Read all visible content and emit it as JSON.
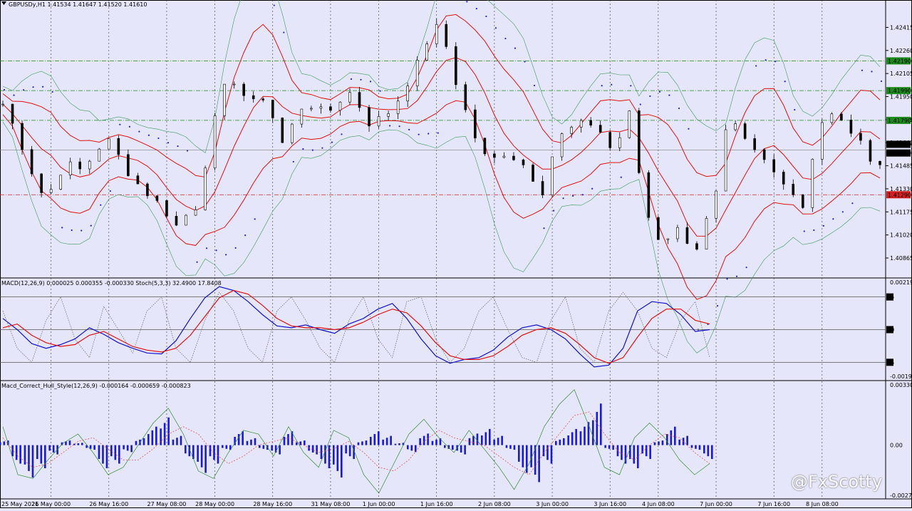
{
  "chart_data": [
    {
      "type": "candlestick",
      "title": "GBPUSDy,H1  1.41534 1.41647 1.41520 1.41610",
      "ylim": [
        1.4075,
        1.4258
      ],
      "price_ticks": [
        "1.42415",
        "1.42260",
        "1.42105",
        "1.41950",
        "1.41795",
        "1.41640",
        "1.41485",
        "1.41330",
        "1.41175",
        "1.41020",
        "1.40865"
      ],
      "price_tick_values": [
        1.42415,
        1.4226,
        1.42105,
        1.4195,
        1.41795,
        1.4164,
        1.41485,
        1.4133,
        1.41175,
        1.4102,
        1.40865
      ],
      "levels": [
        {
          "label": "1.42190",
          "value": 1.4219,
          "color": "#1a8a1a"
        },
        {
          "label": "1.41990",
          "value": 1.4199,
          "color": "#1a8a1a"
        },
        {
          "label": "1.41790",
          "value": 1.4179,
          "color": "#1a8a1a"
        },
        {
          "label": "1.41290",
          "value": 1.4129,
          "color": "#d62020"
        }
      ],
      "price_boxes": [
        {
          "label": "1.41610",
          "value": 1.4161
        },
        {
          "label": "1.41590",
          "value": 1.4159
        }
      ],
      "close_path": [
        [
          0,
          1.419
        ],
        [
          1,
          1.4175
        ],
        [
          2,
          1.4158
        ],
        [
          3,
          1.4138
        ],
        [
          4,
          1.4125
        ],
        [
          5,
          1.4142
        ],
        [
          6,
          1.415
        ],
        [
          7,
          1.4145
        ],
        [
          8,
          1.4152
        ],
        [
          9,
          1.4162
        ],
        [
          10,
          1.4166
        ],
        [
          11,
          1.415
        ],
        [
          12,
          1.414
        ],
        [
          13,
          1.4132
        ],
        [
          14,
          1.4126
        ],
        [
          15,
          1.4118
        ],
        [
          16,
          1.4108
        ],
        [
          17,
          1.4116
        ],
        [
          18,
          1.4122
        ],
        [
          19,
          1.4162
        ],
        [
          20,
          1.4192
        ],
        [
          21,
          1.421
        ],
        [
          22,
          1.4198
        ],
        [
          23,
          1.419
        ],
        [
          24,
          1.4195
        ],
        [
          25,
          1.418
        ],
        [
          26,
          1.416
        ],
        [
          27,
          1.4182
        ],
        [
          28,
          1.4192
        ],
        [
          29,
          1.4186
        ],
        [
          30,
          1.4184
        ],
        [
          31,
          1.4192
        ],
        [
          32,
          1.4198
        ],
        [
          33,
          1.4188
        ],
        [
          34,
          1.4175
        ],
        [
          35,
          1.4182
        ],
        [
          36,
          1.4186
        ],
        [
          37,
          1.42
        ],
        [
          38,
          1.4212
        ],
        [
          39,
          1.423
        ],
        [
          40,
          1.4242
        ],
        [
          41,
          1.4228
        ],
        [
          42,
          1.42
        ],
        [
          43,
          1.418
        ],
        [
          44,
          1.416
        ],
        [
          45,
          1.415
        ],
        [
          46,
          1.4158
        ],
        [
          47,
          1.4155
        ],
        [
          48,
          1.415
        ],
        [
          49,
          1.414
        ],
        [
          50,
          1.413
        ],
        [
          51,
          1.4164
        ],
        [
          52,
          1.4172
        ],
        [
          53,
          1.4175
        ],
        [
          54,
          1.4178
        ],
        [
          55,
          1.4174
        ],
        [
          56,
          1.416
        ],
        [
          57,
          1.4168
        ],
        [
          58,
          1.4186
        ],
        [
          59,
          1.413
        ],
        [
          60,
          1.4105
        ],
        [
          61,
          1.4096
        ],
        [
          62,
          1.4108
        ],
        [
          63,
          1.41
        ],
        [
          64,
          1.4092
        ],
        [
          65,
          1.4112
        ],
        [
          66,
          1.4132
        ],
        [
          67,
          1.4182
        ],
        [
          68,
          1.417
        ],
        [
          69,
          1.416
        ],
        [
          70,
          1.4155
        ],
        [
          71,
          1.4145
        ],
        [
          72,
          1.414
        ],
        [
          73,
          1.413
        ],
        [
          74,
          1.412
        ],
        [
          75,
          1.4165
        ],
        [
          76,
          1.4185
        ],
        [
          77,
          1.418
        ],
        [
          78,
          1.4175
        ],
        [
          79,
          1.4165
        ],
        [
          80,
          1.4155
        ],
        [
          81,
          1.415
        ]
      ],
      "x_ticks": [
        "25 May 2021",
        "26 May 00:00",
        "26 May 16:00",
        "27 May 08:00",
        "28 May 00:00",
        "28 May 16:00",
        "31 May 08:00",
        "1 Jun 00:00",
        "1 Jun 16:00",
        "2 Jun 08:00",
        "3 Jun 00:00",
        "3 Jun 16:00",
        "4 Jun 08:00",
        "7 Jun 00:00",
        "7 Jun 16:00",
        "8 Jun 08:00"
      ],
      "x_tick_index": [
        0,
        5,
        11,
        17,
        22,
        28,
        34,
        39,
        45,
        51,
        57,
        63,
        68,
        74,
        80,
        85
      ]
    },
    {
      "type": "line",
      "title": "MACD(12,26,9) 0.000025 0.000355 -0.000330  Stoch(5,3,3) 32.4900 17.8408",
      "right_ticks": [
        "0.002199",
        "-0.00198"
      ],
      "stoch_levels": [
        {
          "label": "85",
          "value": 85
        },
        {
          "label": "50",
          "value": 50
        },
        {
          "label": "15",
          "value": 15
        }
      ],
      "series": [
        {
          "name": "",
          "color": "#1010d0",
          "values": [
            62,
            50,
            35,
            30,
            34,
            40,
            52,
            45,
            36,
            30,
            25,
            24,
            38,
            62,
            84,
            96,
            92,
            80,
            66,
            54,
            52,
            55,
            50,
            46,
            56,
            62,
            72,
            78,
            62,
            40,
            22,
            14,
            18,
            20,
            28,
            42,
            52,
            55,
            50,
            40,
            24,
            10,
            12,
            30,
            70,
            80,
            78,
            66,
            48,
            50
          ]
        },
        {
          "name": "",
          "color": "#e01010",
          "values": [
            52,
            56,
            44,
            36,
            32,
            34,
            44,
            48,
            40,
            32,
            28,
            26,
            30,
            44,
            64,
            84,
            92,
            88,
            76,
            62,
            54,
            52,
            52,
            50,
            52,
            58,
            66,
            72,
            68,
            54,
            36,
            22,
            18,
            18,
            22,
            32,
            44,
            50,
            52,
            46,
            34,
            20,
            14,
            20,
            42,
            62,
            72,
            72,
            60,
            56
          ]
        },
        {
          "name": "",
          "color": "#606060",
          "dashed": true,
          "values": [
            70,
            30,
            15,
            60,
            85,
            40,
            20,
            75,
            50,
            25,
            70,
            85,
            30,
            15,
            60,
            90,
            70,
            30,
            15,
            70,
            85,
            60,
            30,
            15,
            60,
            85,
            40,
            20,
            80,
            85,
            40,
            15,
            30,
            70,
            85,
            50,
            20,
            15,
            60,
            85,
            30,
            15,
            70,
            90,
            70,
            30,
            20,
            60,
            80,
            20
          ]
        }
      ]
    },
    {
      "type": "bar",
      "title": "Macd_Correct_Hull_Style(12,26,9) -0.000164 -0.000659 -0.000823",
      "right_ticks": [
        "0.003301",
        "0.00",
        "-0.002754"
      ],
      "ylim": [
        -0.002754,
        0.003301
      ],
      "values": [
        0.0002,
        -0.0008,
        -0.0014,
        -0.001,
        -0.0004,
        0.0002,
        0.0001,
        -0.0002,
        -0.001,
        -0.0008,
        -0.0003,
        0.0003,
        0.0008,
        0.0012,
        0.0004,
        -0.0006,
        -0.0012,
        -0.0008,
        -0.0002,
        0.0006,
        0.0003,
        -0.0002,
        -0.0004,
        0.0006,
        0.0002,
        -0.0004,
        -0.001,
        -0.0014,
        -0.0006,
        0.0002,
        0.0006,
        0.0004,
        0.0001,
        -0.0003,
        0.0005,
        0.0003,
        -0.0002,
        -0.0004,
        0.0005,
        0.0007,
        0.0004,
        -0.0002,
        -0.0012,
        -0.0016,
        -0.0008,
        0.0003,
        0.0007,
        0.001,
        0.0018,
        -0.0002,
        -0.0008,
        -0.001,
        -0.0006,
        0.0002,
        0.0008,
        0.0004,
        -0.0002,
        -0.0006
      ],
      "series": [
        {
          "name": "",
          "color": "#2e8b2e",
          "values": [
            0.001,
            -0.0016,
            -0.0018,
            -0.0008,
            0.0001,
            0.0006,
            -0.0004,
            -0.0016,
            -0.0012,
            0.0,
            0.0012,
            0.002,
            0.0006,
            -0.0014,
            -0.0018,
            -0.0004,
            0.0008,
            0.0006,
            -0.0006,
            0.001,
            -0.0004,
            -0.0012,
            0.0008,
            0.0004,
            -0.0016,
            -0.0026,
            -0.001,
            0.0006,
            0.0014,
            0.0004,
            -0.0004,
            0.0008,
            -0.0002,
            -0.0012,
            -0.0024,
            -0.001,
            0.001,
            0.0022,
            0.003,
            0.001,
            -0.0012,
            -0.0016,
            0.0004,
            0.0012,
            0.0004,
            -0.0008,
            -0.0016,
            -0.001
          ]
        },
        {
          "name": "",
          "color": "#e04040",
          "dashed": true,
          "values": [
            0.0004,
            -0.0006,
            -0.0012,
            -0.001,
            -0.0004,
            0.0002,
            0.0004,
            -0.0002,
            -0.0008,
            -0.0008,
            -0.0002,
            0.0006,
            0.001,
            0.0006,
            -0.0004,
            -0.001,
            -0.0006,
            0.0,
            0.0002,
            0.0004,
            0.0,
            -0.0004,
            -0.0002,
            0.0002,
            -0.0004,
            -0.0012,
            -0.0014,
            -0.0008,
            0.0002,
            0.0008,
            0.0004,
            0.0002,
            0.0,
            -0.0006,
            -0.0012,
            -0.0016,
            -0.0004,
            0.0006,
            0.0016,
            0.0018,
            0.0006,
            -0.0004,
            -0.0008,
            0.0,
            0.0006,
            0.0004,
            -0.0004,
            -0.001
          ]
        }
      ]
    }
  ],
  "watermark": "@FxScotty"
}
